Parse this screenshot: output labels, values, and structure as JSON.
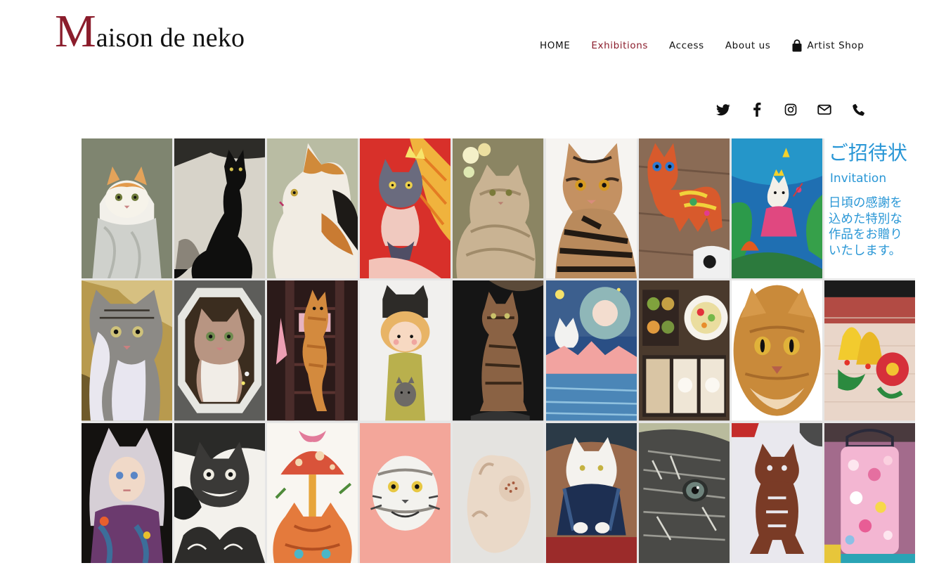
{
  "brand": {
    "initial": "M",
    "rest": "aison de neko"
  },
  "nav": {
    "items": [
      "HOME",
      "Exhibitions",
      "Access",
      "About us"
    ],
    "active": "Exhibitions",
    "shop_label": "Artist Shop"
  },
  "social": [
    "twitter-icon",
    "facebook-icon",
    "instagram-icon",
    "mail-icon",
    "phone-icon"
  ],
  "colors": {
    "brand": "#8b1d2c",
    "invite": "#2a97d6"
  },
  "invitation": {
    "title": "ご招待状",
    "subtitle": "Invitation",
    "lines": [
      "日頃の感謝を",
      "込めた特別な",
      "作品をお贈り",
      "いたします。"
    ]
  },
  "gallery": [
    {
      "desc": "cat in knit scarf"
    },
    {
      "desc": "black cat etching"
    },
    {
      "desc": "calico cat profile"
    },
    {
      "desc": "gray cat with wings"
    },
    {
      "desc": "fluffy cat with flowers"
    },
    {
      "desc": "tabby cat portrait"
    },
    {
      "desc": "colorful felt cat"
    },
    {
      "desc": "batik cat princess"
    },
    {
      "desc": "invitation"
    },
    {
      "desc": "tabby cat on gold"
    },
    {
      "desc": "cat in white frame"
    },
    {
      "desc": "cat climbing shelf"
    },
    {
      "desc": "girl doll with cat"
    },
    {
      "desc": "tabby cat sculpture"
    },
    {
      "desc": "girl and cat painting"
    },
    {
      "desc": "owl and cat sweets"
    },
    {
      "desc": "cat painted stone"
    },
    {
      "desc": "christmas quilling"
    },
    {
      "desc": "doll with cat ears"
    },
    {
      "desc": "cheshire cat print"
    },
    {
      "desc": "mushroom and cat"
    },
    {
      "desc": "pallas cat drawing"
    },
    {
      "desc": "clay cat figure"
    },
    {
      "desc": "white cat figurine"
    },
    {
      "desc": "cat pencil drawing"
    },
    {
      "desc": "cat print textile"
    },
    {
      "desc": "flower lantern"
    }
  ]
}
